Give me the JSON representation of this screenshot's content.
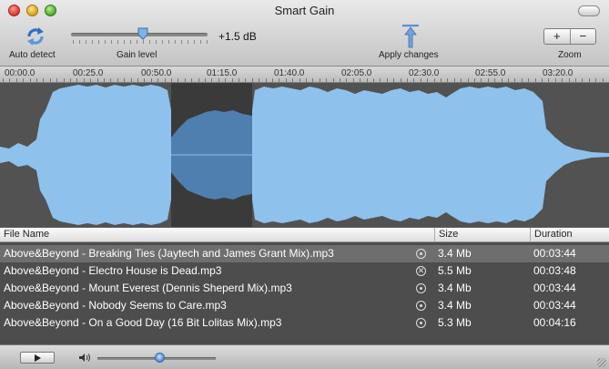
{
  "window": {
    "title": "Smart Gain"
  },
  "toolbar": {
    "auto_detect_label": "Auto detect",
    "gain_level_label": "Gain level",
    "gain_value": "+1.5 dB",
    "apply_label": "Apply changes",
    "zoom_label": "Zoom",
    "zoom_in": "+",
    "zoom_out": "−"
  },
  "timeline": [
    "00:00.0",
    "00:25.0",
    "00:50.0",
    "01:15.0",
    "01:40.0",
    "02:05.0",
    "02:30.0",
    "02:55.0",
    "03:20.0"
  ],
  "table": {
    "headers": {
      "name": "File Name",
      "size": "Size",
      "duration": "Duration"
    },
    "rows": [
      {
        "name": "Above&Beyond - Breaking Ties (Jaytech and James Grant Mix).mp3",
        "status": "ok",
        "size": "3.4 Mb",
        "duration": "00:03:44",
        "selected": true
      },
      {
        "name": "Above&Beyond - Electro House is Dead.mp3",
        "status": "error",
        "size": "5.5 Mb",
        "duration": "00:03:48",
        "selected": false
      },
      {
        "name": "Above&Beyond - Mount Everest (Dennis Sheperd Mix).mp3",
        "status": "ok",
        "size": "3.4 Mb",
        "duration": "00:03:44",
        "selected": false
      },
      {
        "name": "Above&Beyond - Nobody Seems to Care.mp3",
        "status": "ok",
        "size": "3.4 Mb",
        "duration": "00:03:44",
        "selected": false
      },
      {
        "name": "Above&Beyond - On a Good Day (16 Bit Lolitas Mix).mp3",
        "status": "ok",
        "size": "5.3 Mb",
        "duration": "00:04:16",
        "selected": false
      }
    ]
  },
  "colors": {
    "waveform": "#8ec1ec",
    "waveform_selected": "#4f7fae",
    "selection_bg": "#3a3a3a"
  },
  "icons": {
    "auto_detect": "refresh-arrows-icon",
    "apply": "apply-arrow-icon",
    "play": "play-icon",
    "volume": "speaker-icon",
    "status_ok": "radio-dot-icon",
    "status_error": "x-circle-icon"
  }
}
